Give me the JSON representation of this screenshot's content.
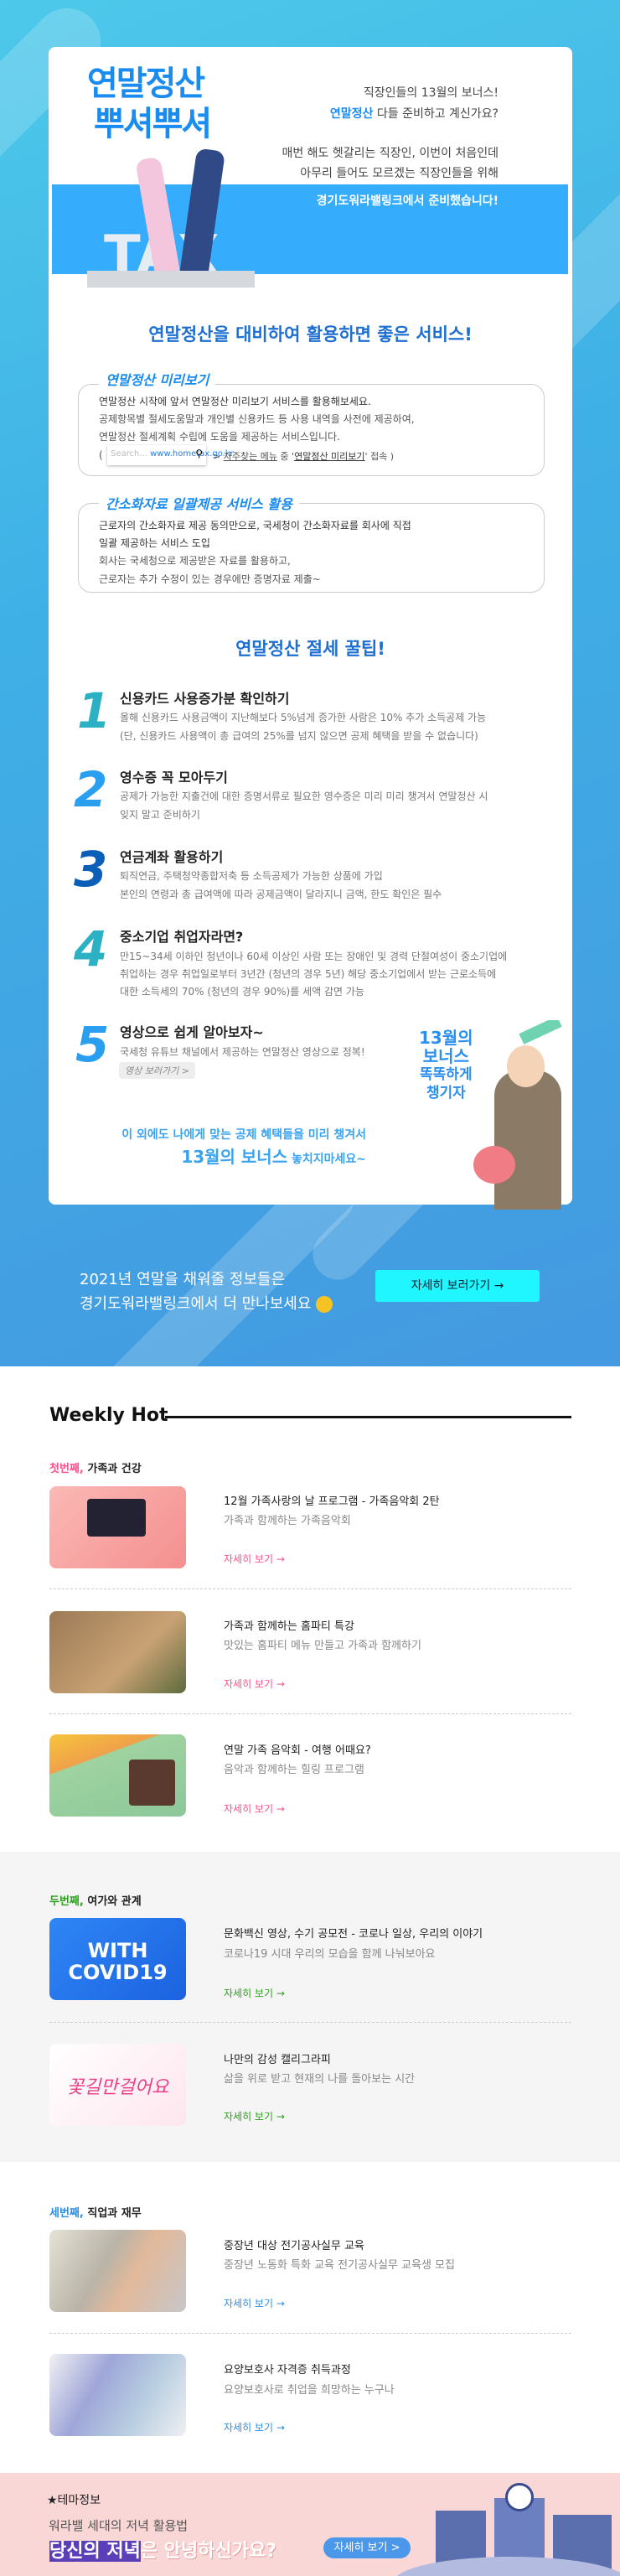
{
  "hero": {
    "logo_line1": "연말정산",
    "logo_line2": "뿌셔뿌셔",
    "tax": "TAX",
    "line1": "직장인들의 13월의 보너스!",
    "line2_accent": "연말정산",
    "line2_rest": " 다들 준비하고 계신가요?",
    "line3": "매번 해도 헷갈리는 직장인, 이번이 처음인데",
    "line4": "아무리 들어도 모르겠는 직장인들을 위해",
    "band_text": "경기도워라밸링크에서 준비했습니다!"
  },
  "services": {
    "heading": "연말정산을 대비하여 활용하면 좋은 서비스!",
    "box1": {
      "title": "연말정산 미리보기",
      "lines": [
        "연말정산 시작에 앞서 연말정산 미리보기 서비스를 활용해보세요.",
        "공제항목별 절세도움말과 개인별 신용카드 등 사용 내역을 사전에 제공하여,",
        "연말정산 절세계획 수립에 도움을 제공하는 서비스입니다."
      ],
      "search_placeholder": "Search...",
      "search_url": "www.hometax.go.kr",
      "path_prefix": "(",
      "path_a": "자주찾는 메뉴",
      "path_b": " 중 '",
      "path_c": "연말정산 미리보기",
      "path_d": "' 접속 )"
    },
    "box2": {
      "title": "간소화자료 일괄제공 서비스 활용",
      "lines": [
        "근로자의 간소화자료 제공 동의만으로, 국세청이 간소화자료를 회사에 직접",
        "일괄 제공하는 서비스 도입",
        "회사는 국세청으로 제공받은 자료를 활용하고,",
        "근로자는 추가 수정이 있는 경우에만 증명자료 제출~"
      ]
    }
  },
  "tips": {
    "heading": "연말정산 절세 꿀팁!",
    "items": [
      {
        "num": "1",
        "title": "신용카드 사용증가분 확인하기",
        "lines": [
          "올해 신용카드 사용금액이 지난해보다 5%넘게 증가한 사람은 10% 추가 소득공제 가능",
          "(단, 신용카드 사용액이 총 급여의 25%를 넘지 않으면 공제 혜택을 받을 수 없습니다)"
        ]
      },
      {
        "num": "2",
        "title": "영수증 꼭 모아두기",
        "lines": [
          "공제가 가능한 지출건에 대한 증명서류로 필요한 영수증은 미리 미리 챙겨서 연말정산 시",
          "잊지 말고 준비하기"
        ]
      },
      {
        "num": "3",
        "title": "연금계좌 활용하기",
        "lines": [
          "퇴직연금, 주택청약종합저축 등 소득공제가 가능한 상품에 가입",
          "본인의 연령과 총 급여액에 따라 공제금액이 달라지니 금액, 한도 확인은 필수"
        ]
      },
      {
        "num": "4",
        "title": "중소기업 취업자라면?",
        "lines": [
          "만15~34세 이하인 청년이나 60세 이상인 사람 또는 장애인 및 경력 단절여성이 중소기업에",
          "취업하는 경우 취업일로부터 3년간 (청년의 경우 5년) 해당 중소기업에서 받는 근로소득에",
          "대한 소득세의 70% (청년의 경우 90%)를 세액 감면 가능"
        ]
      },
      {
        "num": "5",
        "title": "영상으로 쉽게 알아보자~",
        "lines": [
          "국세청 유튜브 채널에서 제공하는 연말정산 영상으로 정복!"
        ]
      }
    ],
    "video_button": "영상 보러가기 >",
    "bonus_art": [
      "13월의",
      "보너스",
      "똑똑하게",
      "챙기자"
    ],
    "closing1": "이 외에도 나에게 맞는 공제 혜택들을 미리 챙겨서",
    "closing2_big": "13월의 보너스",
    "closing2_rest": " 놓치지마세요~"
  },
  "promo": {
    "line1": "2021년 연말을 채워줄 정보들은",
    "line2": "경기도워라밸링크에서 더 만나보세요",
    "button": "자세히 보러가기 →"
  },
  "weekly": {
    "title": "Weekly Hot",
    "link_label": "자세히 보기 →",
    "sections": [
      {
        "ordinal": "첫번째,",
        "name": " 가족과 건강",
        "color": "#ff4f8b",
        "items": [
          {
            "title": "12월 가족사랑의 날 프로그램 - 가족음악회 2탄",
            "sub": "가족과 함께하는 가족음악회"
          },
          {
            "title": "가족과 함께하는 홈파티 특강",
            "sub": "맛있는 홈파티 메뉴 만들고 가족과 함께하기"
          },
          {
            "title": "연말 가족 음악회 - 여행 어때요?",
            "sub": "음악과 함께하는 힐링 프로그램"
          }
        ]
      },
      {
        "ordinal": "두번째,",
        "name": " 여가와 관계",
        "color": "#2ca01c",
        "items": [
          {
            "title": "문화백신 영상, 수기 공모전 - 코로나 일상, 우리의 이야기",
            "sub": "코로나19 시대 우리의 모습을 함께 나눠보아요",
            "img_text": "WITH COVID19"
          },
          {
            "title": "나만의 감성 캘리그라피",
            "sub": "삶을 위로 받고 현재의 나를 돌아보는 시간",
            "img_text": "꽃길만걸어요"
          }
        ]
      },
      {
        "ordinal": "세번째,",
        "name": " 직업과 재무",
        "color": "#2d8de0",
        "items": [
          {
            "title": "중장년 대상 전기공사실무 교육",
            "sub": "중장년 노동화 특화 교육 전기공사실무 교육생 모집"
          },
          {
            "title": "요양보호사 자격증 취득과정",
            "sub": "요양보호사로 취업을 희망하는 누구나"
          }
        ]
      }
    ]
  },
  "theme": {
    "label": "★테마정보",
    "line1": "워라밸 세대의 저녁 활용법",
    "highlight": "당신의 저녁",
    "rest": "은 안녕하신가요?",
    "button": "자세히 보기  >"
  }
}
